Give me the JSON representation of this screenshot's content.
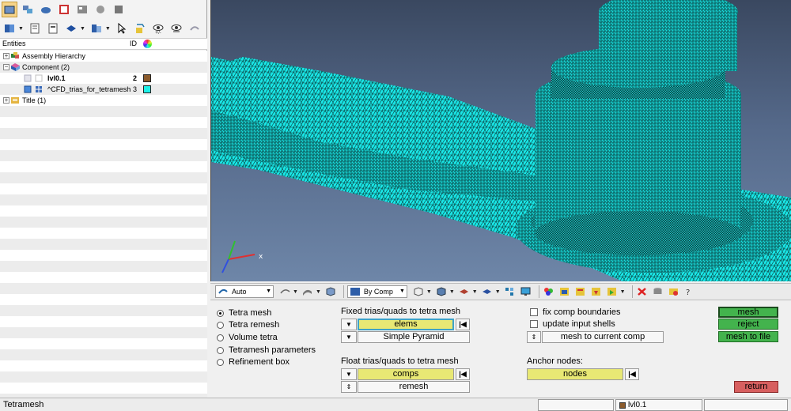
{
  "toolbar_icons_row1": [
    "model-browser-icon",
    "entity-browser-icon",
    "mask-browser-icon",
    "results-icon",
    "session-icon",
    "reference-geometry-icon",
    "utility-icon"
  ],
  "toolbar_icons_row2": [
    "component-view-icon",
    "assembly-view-icon",
    "isolate-icon",
    "show-icon",
    "select-icon",
    "cursor-icon",
    "entity-display-icon",
    "reverse-display-icon",
    "undo-icon"
  ],
  "entities_header": {
    "entities": "Entities",
    "id": "ID"
  },
  "tree": {
    "assembly": "Assembly Hierarchy",
    "component": "Component (2)",
    "comp1": {
      "label": "lvl0.1",
      "id": "2",
      "color": "#8b5a2b"
    },
    "comp2": {
      "label": "^CFD_trias_for_tetramesh",
      "id": "3",
      "color": "#1ff1e8"
    },
    "title": "Title (1)"
  },
  "mesh_color": "#19e6e6",
  "view_toolbar": {
    "auto": "Auto",
    "by_comp": "By Comp"
  },
  "panel": {
    "radios": [
      "Tetra mesh",
      "Tetra remesh",
      "Volume tetra",
      "Tetramesh parameters",
      "Refinement box"
    ],
    "selected_radio": "Tetra mesh",
    "fixed_label": "Fixed trias/quads to tetra mesh",
    "elems": "elems",
    "simple_pyramid": "Simple Pyramid",
    "float_label": "Float trias/quads to tetra mesh",
    "comps": "comps",
    "remesh": "remesh",
    "fix_comp_boundaries": "fix comp boundaries",
    "update_input_shells": "update input shells",
    "mesh_to_current_comp": "mesh to current comp",
    "anchor_label": "Anchor nodes:",
    "nodes": "nodes",
    "mesh_btn": "mesh",
    "reject_btn": "reject",
    "mesh_to_file_btn": "mesh to file",
    "return_btn": "return"
  },
  "status": {
    "left": "Tetramesh",
    "component": "lvl0.1"
  }
}
